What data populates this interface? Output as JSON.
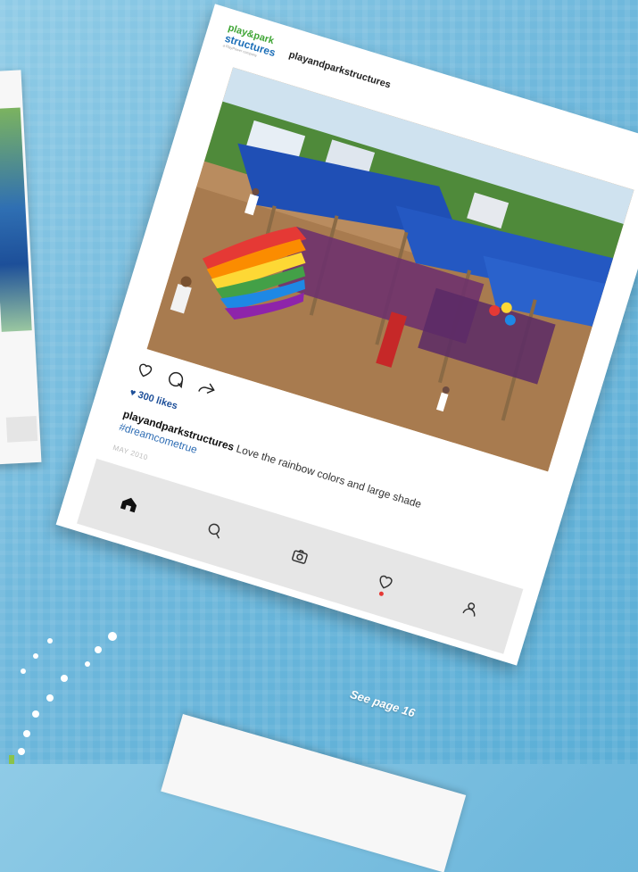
{
  "post": {
    "logo": {
      "line1": "play&park",
      "line2": "structures",
      "tagline": "a PlayPower company"
    },
    "username": "playandparkstructures",
    "likes": "300 likes",
    "caption": {
      "user": "playandparkstructures",
      "text_before_tag": " Love the rainbow colors and large shade ",
      "hashtag": "#dreamcometrue"
    },
    "date": "MAY 2010",
    "actions": [
      "heart-icon",
      "comment-icon",
      "share-icon"
    ],
    "tabs": [
      "home-icon",
      "search-icon",
      "camera-icon",
      "heart-icon",
      "profile-icon"
    ]
  },
  "footer": {
    "see_page": "See page 16"
  },
  "colors": {
    "brand_blue": "#1d6fb8",
    "brand_green": "#3fa535",
    "background": "#6fb8dc",
    "notification": "#e53935"
  }
}
